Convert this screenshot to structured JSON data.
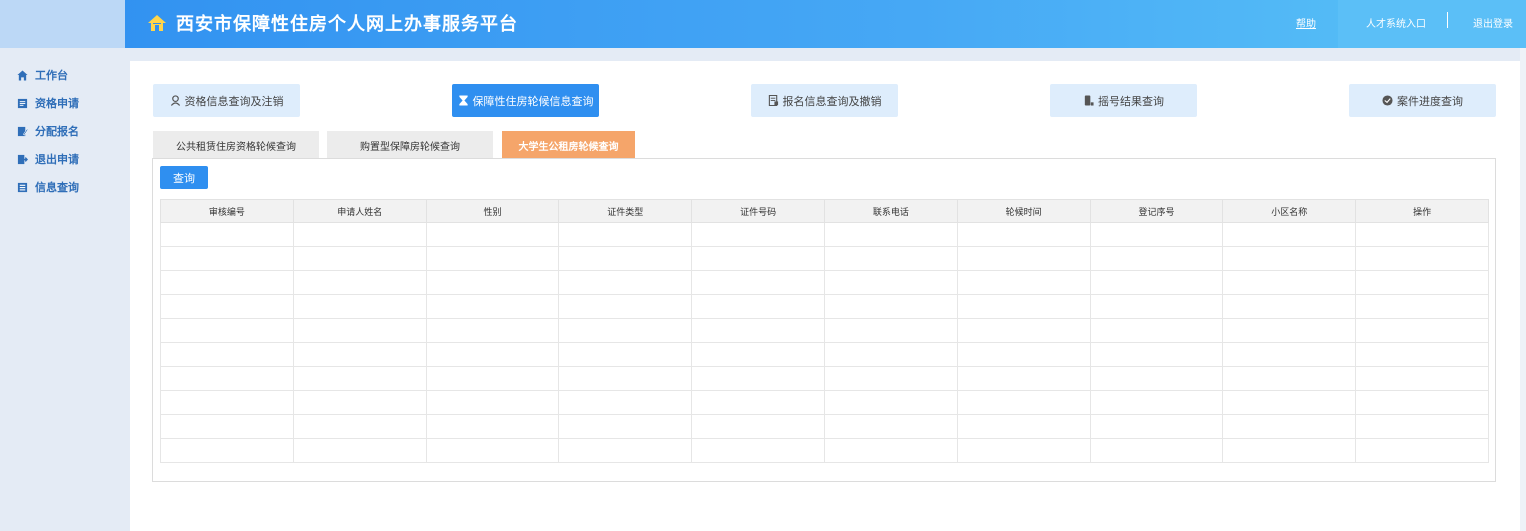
{
  "header": {
    "title": "西安市保障性住房个人网上办事服务平台",
    "help": "帮助",
    "talent_entry": "人才系统入口",
    "logout": "退出登录"
  },
  "sidebar": {
    "items": [
      {
        "label": "工作台",
        "icon": "home-icon"
      },
      {
        "label": "资格申请",
        "icon": "form-icon"
      },
      {
        "label": "分配报名",
        "icon": "edit-icon"
      },
      {
        "label": "退出申请",
        "icon": "exit-icon"
      },
      {
        "label": "信息查询",
        "icon": "info-icon"
      }
    ]
  },
  "top_buttons": [
    {
      "label": "资格信息查询及注销",
      "icon": "person-icon"
    },
    {
      "label": "保障性住房轮候信息查询",
      "icon": "hourglass-icon",
      "active": true
    },
    {
      "label": "报名信息查询及撤销",
      "icon": "document-icon"
    },
    {
      "label": "摇号结果查询",
      "icon": "phone-icon"
    },
    {
      "label": "案件进度查询",
      "icon": "progress-icon"
    }
  ],
  "tabs": [
    {
      "label": "公共租赁住房资格轮候查询"
    },
    {
      "label": "购置型保障房轮候查询"
    },
    {
      "label": "大学生公租房轮候查询",
      "active": true
    }
  ],
  "query_button": "查询",
  "table": {
    "columns": [
      "审核编号",
      "申请人姓名",
      "性别",
      "证件类型",
      "证件号码",
      "联系电话",
      "轮候时间",
      "登记序号",
      "小区名称",
      "操作"
    ],
    "row_count": 10
  },
  "colors": {
    "primary": "#2f8ff0",
    "active_tab": "#f5a56a",
    "sidebar_text": "#2f6eb8"
  }
}
